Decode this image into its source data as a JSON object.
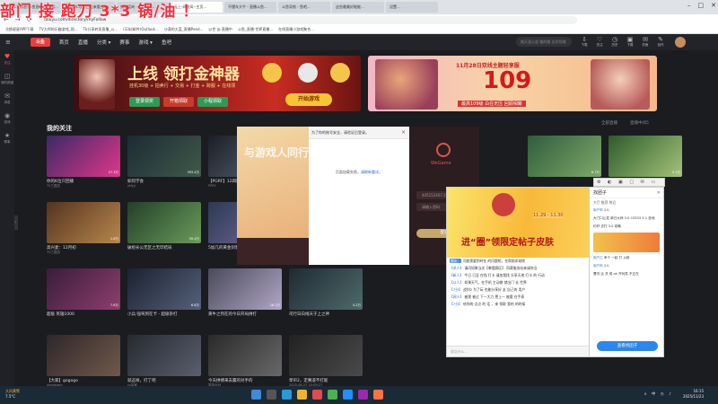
{
  "overlay": {
    "title": "部门 接 跑刀 3*3 锅/油 ！"
  },
  "browser": {
    "tabs": [
      {
        "label": "(1条消息)斗鱼直播-每日看..."
      },
      {
        "label": "有时DC攻时日出来看_pp..."
      },
      {
        "label": "钢球猛肉 - 斗鱼视频..."
      },
      {
        "label": "无上-网络风--主页..."
      },
      {
        "label": "不懂车大牛 - 直播斗鱼..."
      },
      {
        "label": "斗鱼导航 - 鱼吧..."
      },
      {
        "label": "这些最美好能能..."
      },
      {
        "label": "设置..."
      }
    ],
    "url": "douyu.com/directory/myFollow",
    "bookmarks": [
      {
        "label": "兑换星星APP下载"
      },
      {
        "label": "TV大师的乐趣游戏_视..."
      },
      {
        "label": "Tk分享转发直播_斗..."
      },
      {
        "label": "(33封邮件)Outlook..."
      },
      {
        "label": "沙漠的大蓝_直播Peed..."
      },
      {
        "label": "以世 @ 直播中"
      },
      {
        "label": "斗鱼_直播-世界直播..."
      },
      {
        "label": "在线直播小游戏聚合..."
      }
    ]
  },
  "header": {
    "logo": "斗鱼",
    "nav": [
      {
        "label": "首页"
      },
      {
        "label": "直播"
      },
      {
        "label": "分类 ▾"
      },
      {
        "label": "赛事"
      },
      {
        "label": "游戏 ▾"
      },
      {
        "label": "鱼吧"
      }
    ],
    "search_placeholder": "搜天涯火涯 猫的猫 达学领域",
    "icons": [
      {
        "label": "下载"
      },
      {
        "label": "关注"
      },
      {
        "label": "历史"
      },
      {
        "label": "下载"
      },
      {
        "label": "钓鱼"
      },
      {
        "label": "创作"
      }
    ]
  },
  "sidebar": {
    "items": [
      {
        "label": "关注"
      },
      {
        "label": "我的频道"
      },
      {
        "label": "消息"
      },
      {
        "label": "游戏"
      },
      {
        "label": "赛事"
      }
    ]
  },
  "banner_left": {
    "main": "上线 领打金神器",
    "sub": "挂机30级 + 拍卖行 + 交易 + 打金 + 跨服 + 在线领",
    "buttons": [
      {
        "label": "登录领奖"
      },
      {
        "label": "开箱领取"
      },
      {
        "label": "小程领取"
      }
    ],
    "cta": "开始游戏"
  },
  "banner_right": {
    "top": "11月28日双线主题轻享服",
    "number": "109",
    "bottom": "最高109级 白在无压 回顾相聚"
  },
  "follow": {
    "title": "我的关注",
    "links": [
      {
        "label": "全部直播"
      },
      {
        "label": "直播中间5"
      }
    ]
  },
  "cards": [
    {
      "caption": "你的K位只回播",
      "sub": "TV三国志",
      "count": "27.3万"
    },
    {
      "caption": "如何学会",
      "sub": "ytfyjj",
      "count": "393.4万"
    },
    {
      "caption": "【PGRF】12四区",
      "sub": "FPSY",
      "count": "2.3万"
    },
    {
      "caption": "",
      "sub": "",
      "count": ""
    },
    {
      "caption": "",
      "sub": "",
      "count": ""
    },
    {
      "caption": "",
      "sub": "",
      "count": "6.7万"
    },
    {
      "caption": "",
      "sub": "",
      "count": "5.1万"
    },
    {
      "caption": "战术分钟",
      "sub": "",
      "count": "4.9万"
    },
    {
      "caption": "高兴麦：12月初",
      "sub": "TV三国志",
      "count": "1.8万"
    },
    {
      "caption": "破组长公无区之无印结局",
      "sub": "",
      "count": "59.4万"
    },
    {
      "caption": "5加几的黄金剑客",
      "sub": "",
      "count": "17.4万"
    },
    {
      "caption": "超级 英雄1000",
      "sub": "",
      "count": "7.6万"
    },
    {
      "caption": "小兵:强驾到在卡 - 超级杂打",
      "sub": "",
      "count": "6.8万"
    },
    {
      "caption": "黄牛之列在的今日开局拼打",
      "sub": "",
      "count": "18.1万"
    },
    {
      "caption": "司行日白线天于上之神",
      "sub": "",
      "count": "4.2万"
    },
    {
      "caption": "【大家】gogogo",
      "sub": "xinxiaoxin",
      "count": ""
    },
    {
      "caption": "就这样，打了吧",
      "sub": "cc赢家",
      "count": ""
    },
    {
      "caption": "今天拼搏来去赢的对手的",
      "sub": "笑话大对",
      "count": ""
    },
    {
      "caption": "草帘2，定赛道不打能",
      "sub": "2025-08-27 10:09:27",
      "count": ""
    }
  ],
  "dialog": {
    "title": "为了你的账号安全，请验证后登录。",
    "body": "页面加载失败，",
    "link": "请刷新重试。",
    "close": "×"
  },
  "wegame": {
    "brand": "WeGame",
    "account": "445152467.2",
    "password": "请输入密码",
    "login": "登录"
  },
  "chat": {
    "banner_title": "进“圈”领限定帖子皮肤",
    "banner_date": "11.29 - 11.30",
    "messages": [
      {
        "user": "圈友：",
        "text": "可能需要到时在 的问题呢，在帮助求助呢"
      },
      {
        "user": "【求人】",
        "text": "请问如果当次【拳擂赛区】 同赛服务站来请你当"
      },
      {
        "user": "【新人】",
        "text": "今日 已没 在找 打卡 请加我找 分享天地 打卡 的 行动"
      },
      {
        "user": "【以人】",
        "text": "如果天气，在手机 主动做 就出门 去 世界"
      },
      {
        "user": "【7分】",
        "text": "战利2 为了玩 也能分享好 友 自己的 用户"
      },
      {
        "user": "【闻人】",
        "text": "被需 被过 下一大力 把上一 被要 在手表"
      },
      {
        "user": "【7分】",
        "text": "给你的 点点 的 话 ，来 领取 我的 的时候"
      }
    ],
    "input_hint": "说点什么..."
  },
  "group": {
    "title": "找团子",
    "tabs": "大厅  推荐  附近",
    "items": [
      {
        "user": "用户甲",
        "text": "2人"
      },
      {
        "user": "",
        "text": "大门口让发 新日大师 3.0 CS333 3-1 圣地"
      },
      {
        "user": "",
        "text": "约好 去打 3.0 攻略"
      },
      {
        "user": "用户乙",
        "text": "来个 一起 打 以前"
      },
      {
        "user": "用户丙",
        "text": "2人"
      },
      {
        "user": "",
        "text": "曹刘 比 关 成 ok 开玩笑 不正在"
      }
    ],
    "button": "查看找团子"
  },
  "qq_toolbar": "⚙ ◐ ▣ ▢ ✉ ▭ ⊟ ✕",
  "taskbar": {
    "weather_temp": "大风黄警",
    "weather_sub": "7.5°C",
    "clock_time": "16:15",
    "clock_date": "2025/11/23",
    "tray": "ʌ 中 ◷ ♪"
  },
  "colors": {
    "brand": "#f03b3b",
    "accent_blue": "#2c86f0",
    "overlay_red": "#ff2b3a"
  }
}
